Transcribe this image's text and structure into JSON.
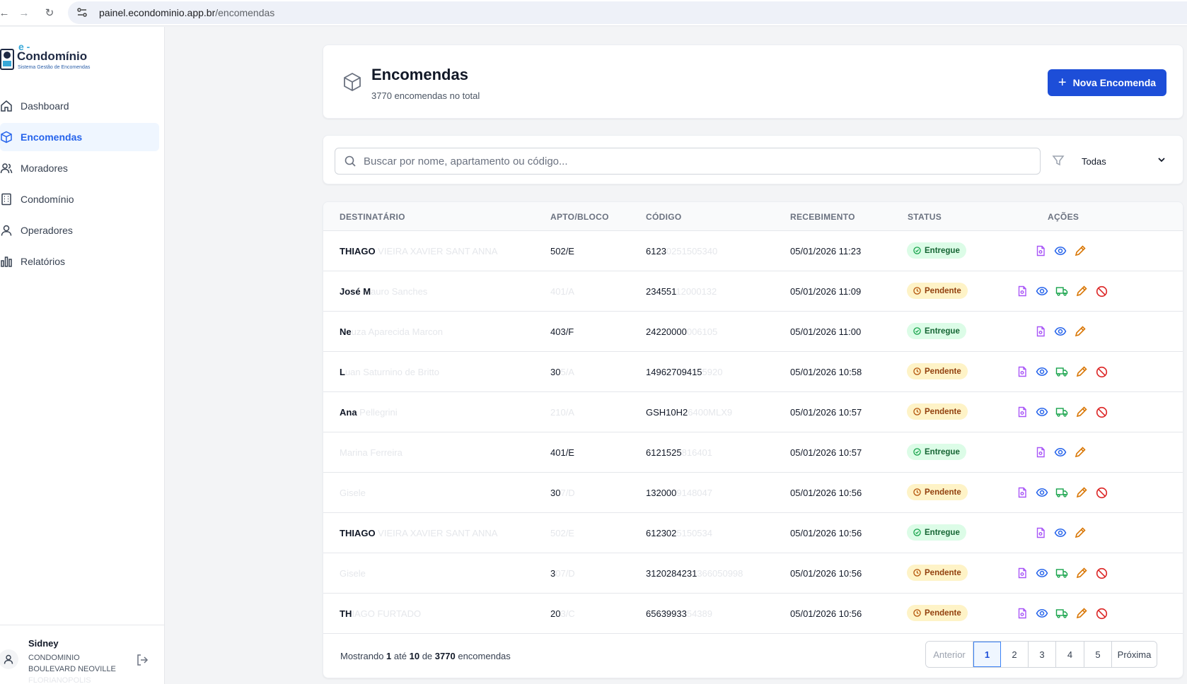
{
  "browser": {
    "url_host": "painel.econdominio.app.br",
    "url_path": "/encomendas"
  },
  "brand": {
    "prefix": "e -",
    "name": "Condomínio",
    "tagline": "Sistema Gestão de Encomendas"
  },
  "sidebar": {
    "items": [
      {
        "label": "Dashboard",
        "icon": "home-icon"
      },
      {
        "label": "Encomendas",
        "icon": "box-icon"
      },
      {
        "label": "Moradores",
        "icon": "users-icon"
      },
      {
        "label": "Condomínio",
        "icon": "building-icon"
      },
      {
        "label": "Operadores",
        "icon": "user-icon"
      },
      {
        "label": "Relatórios",
        "icon": "bar-chart-icon"
      }
    ],
    "active_index": 1
  },
  "user": {
    "name": "Sidney",
    "org_line1": "CONDOMINIO",
    "org_line2": "BOULEVARD NEOVILLE",
    "org_line3": "FLORIANOPOLIS"
  },
  "header": {
    "title": "Encomendas",
    "subtitle": "3770 encomendas no total",
    "new_button": "Nova Encomenda"
  },
  "filters": {
    "search_placeholder": "Buscar por nome, apartamento ou código...",
    "status_value": "Todas"
  },
  "table": {
    "headers": [
      "DESTINATÁRIO",
      "APTO/BLOCO",
      "CÓDIGO",
      "RECEBIMENTO",
      "STATUS",
      "AÇÕES"
    ],
    "rows": [
      {
        "name": "THIAGO",
        "name_rest": " VIEIRA XAVIER SANT ANNA",
        "apto": "502/E",
        "codigo": "6123",
        "codigo_rest": "0251505340",
        "data": "05/01/2026 11:23",
        "status": "Entregue"
      },
      {
        "name": "José M",
        "name_rest": "auro Sanches",
        "apto": "",
        "apto_rest": "401/A",
        "codigo": "234551",
        "codigo_rest": "12000132",
        "data": "05/01/2026 11:09",
        "status": "Pendente"
      },
      {
        "name": "Ne",
        "name_rest": "uza Aparecida Marcon",
        "apto": "403/F",
        "codigo": "24220000",
        "codigo_rest": "006105",
        "data": "05/01/2026 11:00",
        "status": "Entregue"
      },
      {
        "name": "L",
        "name_rest": "uan Saturnino de Britto",
        "apto": "30",
        "apto_rest": "5/A",
        "codigo": "14962709415",
        "codigo_rest": "5920",
        "data": "05/01/2026 10:58",
        "status": "Pendente"
      },
      {
        "name": "Ana",
        "name_rest": " Pellegrini",
        "apto": "",
        "apto_rest": "210/A",
        "codigo": "GSH10H2",
        "codigo_rest": "6400MLX9",
        "data": "05/01/2026 10:57",
        "status": "Pendente"
      },
      {
        "name": "",
        "name_rest": "Marina Ferreira",
        "apto": "401/E",
        "codigo": "6121525",
        "codigo_rest": "816401",
        "data": "05/01/2026 10:57",
        "status": "Entregue"
      },
      {
        "name": "",
        "name_rest": "Gisele",
        "apto": "30",
        "apto_rest": "7/D",
        "codigo": "132000",
        "codigo_rest": "9148047",
        "data": "05/01/2026 10:56",
        "status": "Pendente"
      },
      {
        "name": "THIAGO",
        "name_rest": " VIEIRA XAVIER SANT ANNA",
        "apto": "",
        "apto_rest": "502/E",
        "codigo": "612302",
        "codigo_rest": "5150534",
        "data": "05/01/2026 10:56",
        "status": "Entregue"
      },
      {
        "name": "",
        "name_rest": "Gisele",
        "apto": "3",
        "apto_rest": "07/D",
        "codigo": "3120284231",
        "codigo_rest": "366050998",
        "data": "05/01/2026 10:56",
        "status": "Pendente"
      },
      {
        "name": "TH",
        "name_rest": "IAGO FURTADO",
        "apto": "20",
        "apto_rest": "3/C",
        "codigo": "65639933",
        "codigo_rest": "54389",
        "data": "05/01/2026 10:56",
        "status": "Pendente"
      }
    ]
  },
  "footer": {
    "showing_prefix": "Mostrando",
    "from": "1",
    "to_word": "até",
    "to": "10",
    "of_word": "de",
    "total": "3770",
    "suffix": "encomendas"
  },
  "pagination": {
    "prev": "Anterior",
    "pages": [
      "1",
      "2",
      "3",
      "4",
      "5"
    ],
    "current": "1",
    "next": "Próxima"
  },
  "colors": {
    "accent": "#1d4ed8",
    "entregue_bg": "#dcfce7",
    "pendente_bg": "#fef3c7",
    "action_doc": "#a855f7",
    "action_view": "#2563eb",
    "action_deliver": "#16a34a",
    "action_edit": "#d97706",
    "action_cancel": "#dc2626"
  }
}
